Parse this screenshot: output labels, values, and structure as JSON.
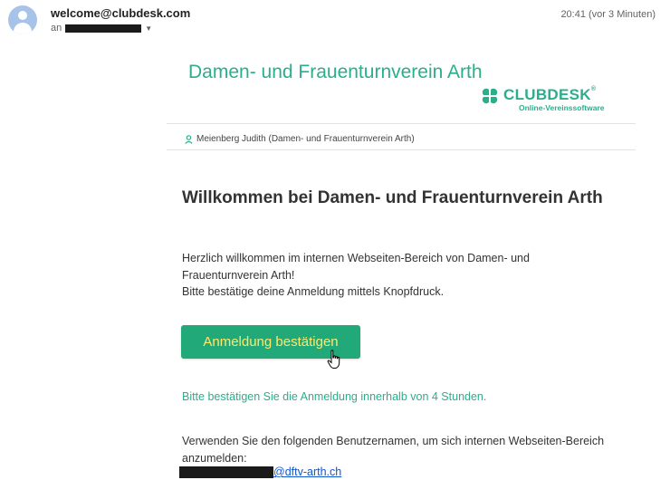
{
  "header": {
    "sender": "welcome@clubdesk.com",
    "recipient_prefix": "an",
    "timestamp": "20:41 (vor 3 Minuten)"
  },
  "club": {
    "title": "Damen- und Frauenturnverein Arth",
    "logo_word": "CLUBDESK",
    "logo_reg": "®",
    "logo_sub": "Online-Vereinssoftware",
    "brand_color": "#2bae8c"
  },
  "user_line": {
    "icon": "user-icon",
    "text": "Meienberg Judith (Damen- und Frauenturnverein Arth)"
  },
  "message": {
    "title": "Willkommen bei Damen- und Frauenturnverein Arth",
    "intro_line1": "Herzlich willkommen im internen Webseiten-Bereich von Damen- und Frauenturnverein Arth!",
    "intro_line2": "Bitte bestätige deine Anmeldung mittels Knopfdruck.",
    "button_label": "Anmeldung bestätigen",
    "button_color": "#22a979",
    "button_text_color": "#ffe86a",
    "deadline": "Bitte bestätigen Sie die Anmeldung innerhalb von 4 Stunden.",
    "username_info": "Verwenden Sie den folgenden Benutzernamen, um sich internen Webseiten-Bereich anzumelden:",
    "email_domain": "@dftv-arth.ch"
  }
}
